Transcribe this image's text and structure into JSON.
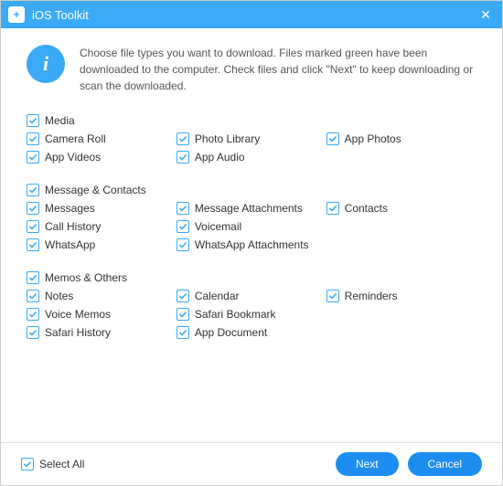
{
  "titlebar": {
    "title": "iOS Toolkit"
  },
  "info": {
    "text": "Choose file types you want to download. Files marked green have been downloaded to the computer. Check files and click \"Next\" to keep downloading or scan the downloaded."
  },
  "groups": [
    {
      "name": "media",
      "header": {
        "label": "Media",
        "checked": true
      },
      "rows": [
        [
          {
            "label": "Camera Roll",
            "checked": true
          },
          {
            "label": "Photo Library",
            "checked": true
          },
          {
            "label": "App Photos",
            "checked": true
          }
        ],
        [
          {
            "label": "App Videos",
            "checked": true
          },
          {
            "label": "App Audio",
            "checked": true
          }
        ]
      ]
    },
    {
      "name": "message-contacts",
      "header": {
        "label": "Message & Contacts",
        "checked": true
      },
      "rows": [
        [
          {
            "label": "Messages",
            "checked": true
          },
          {
            "label": "Message Attachments",
            "checked": true
          },
          {
            "label": "Contacts",
            "checked": true
          }
        ],
        [
          {
            "label": "Call History",
            "checked": true
          },
          {
            "label": "Voicemail",
            "checked": true
          }
        ],
        [
          {
            "label": "WhatsApp",
            "checked": true
          },
          {
            "label": "WhatsApp Attachments",
            "checked": true
          }
        ]
      ]
    },
    {
      "name": "memos-others",
      "header": {
        "label": "Memos & Others",
        "checked": true
      },
      "rows": [
        [
          {
            "label": "Notes",
            "checked": true
          },
          {
            "label": "Calendar",
            "checked": true
          },
          {
            "label": "Reminders",
            "checked": true
          }
        ],
        [
          {
            "label": "Voice Memos",
            "checked": true
          },
          {
            "label": "Safari Bookmark",
            "checked": true
          }
        ],
        [
          {
            "label": "Safari History",
            "checked": true
          },
          {
            "label": "App Document",
            "checked": true
          }
        ]
      ]
    }
  ],
  "footer": {
    "select_all": {
      "label": "Select All",
      "checked": true
    },
    "next": "Next",
    "cancel": "Cancel"
  },
  "colors": {
    "accent": "#3aaaf8",
    "button": "#1d8df0"
  }
}
